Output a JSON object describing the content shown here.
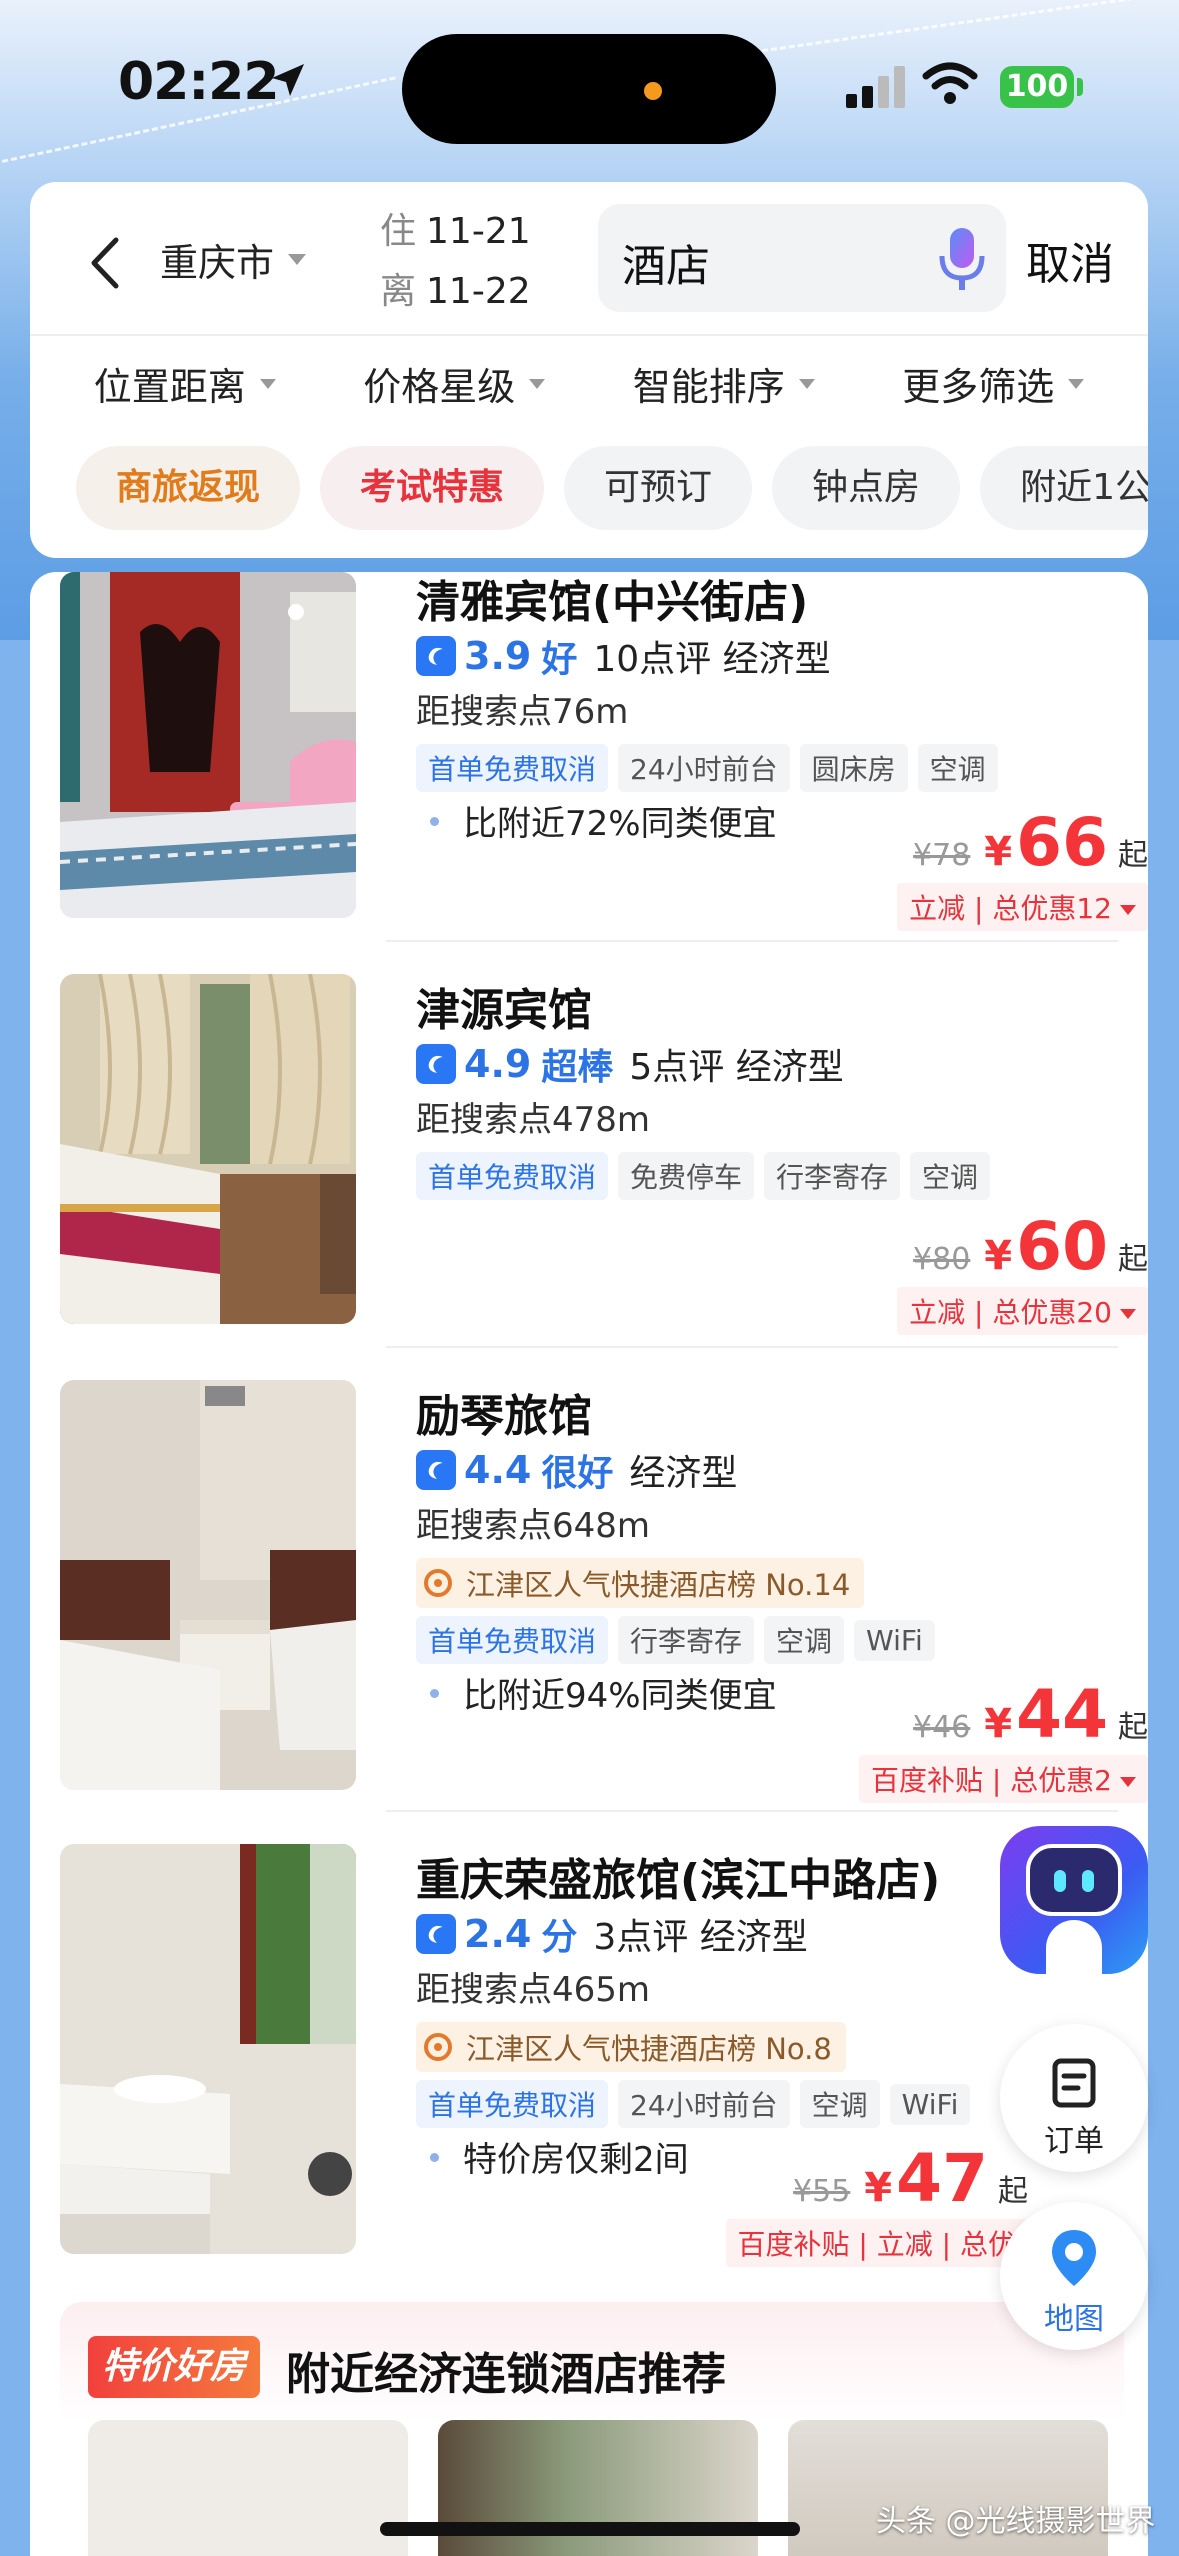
{
  "status": {
    "time": "02:22",
    "battery": "100"
  },
  "header": {
    "city": "重庆市",
    "checkin_label": "住",
    "checkin": "11-21",
    "checkout_label": "离",
    "checkout": "11-22",
    "search_value": "酒店",
    "cancel_label": "取消"
  },
  "filters": [
    "位置距离",
    "价格星级",
    "智能排序",
    "更多筛选"
  ],
  "chips": [
    "商旅返现",
    "考试特惠",
    "可预订",
    "钟点房",
    "附近1公"
  ],
  "hotels": [
    {
      "name": "清雅宾馆(中兴街店)",
      "score": "3.9",
      "score_label": "好",
      "review_info": "10点评 经济型",
      "distance": "距搜索点76m",
      "rank": "",
      "tags": [
        "首单免费取消",
        "24小时前台",
        "圆床房",
        "空调"
      ],
      "note": "比附近72%同类便宜",
      "orig_price": "¥78",
      "currency": "¥",
      "price": "66",
      "qi": "起",
      "promo": "立减 | 总优惠12"
    },
    {
      "name": "津源宾馆",
      "score": "4.9",
      "score_label": "超棒",
      "review_info": "5点评 经济型",
      "distance": "距搜索点478m",
      "rank": "",
      "tags": [
        "首单免费取消",
        "免费停车",
        "行李寄存",
        "空调"
      ],
      "note": "",
      "orig_price": "¥80",
      "currency": "¥",
      "price": "60",
      "qi": "起",
      "promo": "立减 | 总优惠20"
    },
    {
      "name": "励琴旅馆",
      "score": "4.4",
      "score_label": "很好",
      "review_info": "经济型",
      "distance": "距搜索点648m",
      "rank": "江津区人气快捷酒店榜 No.14",
      "tags": [
        "首单免费取消",
        "行李寄存",
        "空调",
        "WiFi"
      ],
      "note": "比附近94%同类便宜",
      "orig_price": "¥46",
      "currency": "¥",
      "price": "44",
      "qi": "起",
      "promo": "百度补贴 | 总优惠2"
    },
    {
      "name": "重庆荣盛旅馆(滨江中路店)",
      "score": "2.4",
      "score_label": "分",
      "review_info": "3点评 经济型",
      "distance": "距搜索点465m",
      "rank": "江津区人气快捷酒店榜 No.8",
      "tags": [
        "首单免费取消",
        "24小时前台",
        "空调",
        "WiFi"
      ],
      "note": "特价房仅剩2间",
      "orig_price": "¥55",
      "currency": "¥",
      "price": "47",
      "qi": "起",
      "promo": "百度补贴 | 立减 | 总优"
    }
  ],
  "floating": {
    "orders_label": "订单",
    "map_label": "地图"
  },
  "recommend": {
    "badge": "特价好房",
    "title": "附近经济连锁酒店推荐"
  },
  "watermark": "头条 @光线摄影世界"
}
